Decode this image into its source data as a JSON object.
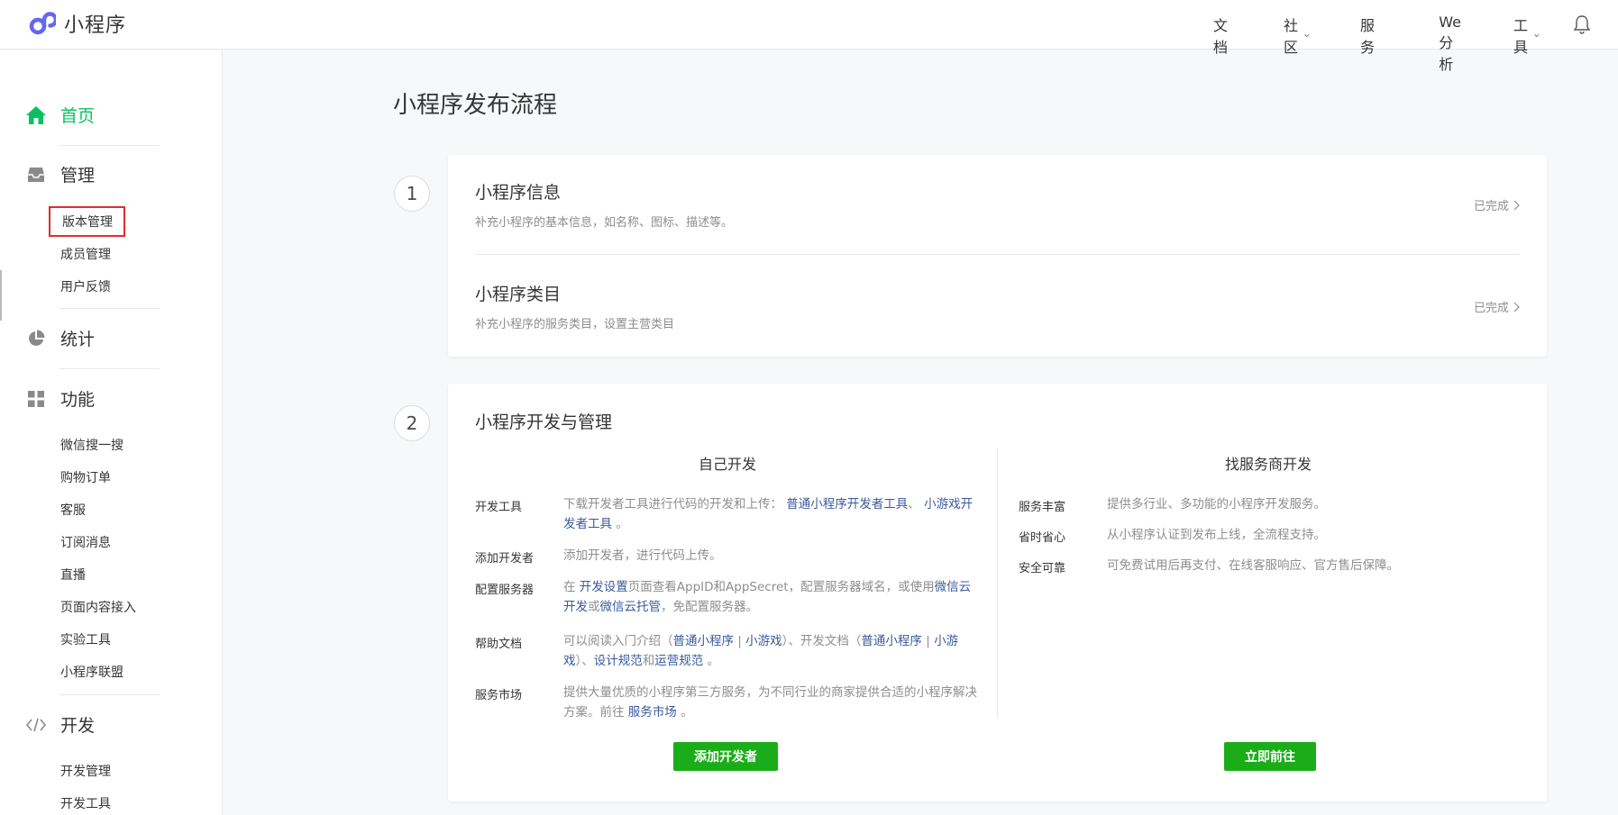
{
  "header": {
    "logo_text": "小程序",
    "nav": [
      {
        "label": "文档",
        "has_caret": false
      },
      {
        "label": "社区",
        "has_caret": true
      },
      {
        "label": "服务",
        "has_caret": false
      },
      {
        "label": "We分析",
        "has_caret": false
      },
      {
        "label": "工具",
        "has_caret": true
      }
    ]
  },
  "sidebar": {
    "home": "首页",
    "manage": {
      "label": "管理",
      "items": [
        "版本管理",
        "成员管理",
        "用户反馈"
      ]
    },
    "stats": {
      "label": "统计"
    },
    "features": {
      "label": "功能",
      "items": [
        "微信搜一搜",
        "购物订单",
        "客服",
        "订阅消息",
        "直播",
        "页面内容接入",
        "实验工具",
        "小程序联盟"
      ]
    },
    "develop": {
      "label": "开发",
      "items": [
        "开发管理",
        "开发工具"
      ]
    }
  },
  "main": {
    "title": "小程序发布流程",
    "step1": {
      "number": "1",
      "rows": [
        {
          "title": "小程序信息",
          "desc": "补充小程序的基本信息，如名称、图标、描述等。",
          "status": "已完成"
        },
        {
          "title": "小程序类目",
          "desc": "补充小程序的服务类目，设置主营类目",
          "status": "已完成"
        }
      ]
    },
    "step2": {
      "number": "2",
      "title": "小程序开发与管理",
      "self_dev": {
        "heading": "自己开发",
        "rows": [
          {
            "label": "开发工具",
            "t1": "下载开发者工具进行代码的开发和上传：",
            "l1": "普通小程序开发者工具",
            "t2": "、",
            "l2": "小游戏开发者工具",
            "t3": "。"
          },
          {
            "label": "添加开发者",
            "text": "添加开发者，进行代码上传。"
          },
          {
            "label": "配置服务器",
            "t1": "在",
            "l1": "开发设置",
            "t2": "页面查看AppID和AppSecret，配置服务器域名，或使用",
            "l2": "微信云开发",
            "t3": "或",
            "l3": "微信云托管",
            "t4": "，免配置服务器。"
          },
          {
            "label": "帮助文档",
            "t1": "可以阅读入门介绍（",
            "l1": "普通小程序",
            "t2": "|",
            "l2": "小游戏",
            "t3": "）、开发文档（",
            "l3": "普通小程序",
            "t4": "|",
            "l4": "小游戏",
            "t5": "）、",
            "l5": "设计规范",
            "t6": "和",
            "l6": "运营规范",
            "t7": "。"
          },
          {
            "label": "服务市场",
            "t1": "提供大量优质的小程序第三方服务，为不同行业的商家提供合适的小程序解决方案。前往",
            "l1": "服务市场",
            "t2": "。"
          }
        ],
        "button": "添加开发者"
      },
      "vendor_dev": {
        "heading": "找服务商开发",
        "rows": [
          {
            "label": "服务丰富",
            "text": "提供多行业、多功能的小程序开发服务。"
          },
          {
            "label": "省时省心",
            "text": "从小程序认证到发布上线，全流程支持。"
          },
          {
            "label": "安全可靠",
            "text": "可免费试用后再支付、在线客服响应、官方售后保障。"
          }
        ],
        "button": "立即前往"
      }
    }
  },
  "colors": {
    "brand_green": "#07c160",
    "button_green": "#1aad19",
    "link_blue": "#3a5a9b",
    "logo_purple": "#6467f0",
    "highlight_red": "#e02d2d"
  }
}
